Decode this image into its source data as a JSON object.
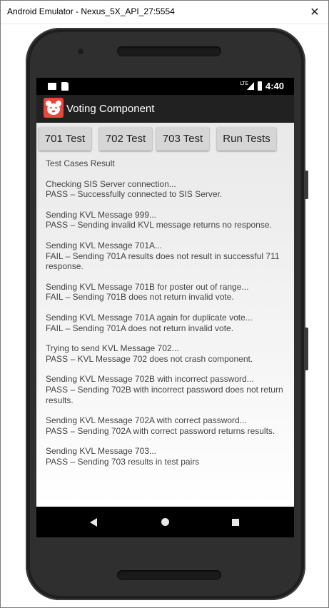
{
  "window": {
    "title": "Android Emulator - Nexus_5X_API_27:5554",
    "close_glyph": "✕"
  },
  "statusbar": {
    "lte": "LTE",
    "time": "4:40",
    "icons": [
      "notification-icon",
      "sdcard-icon",
      "signal-icon",
      "battery-icon"
    ]
  },
  "app": {
    "title": "Voting Component",
    "icon_color": "#e8483b"
  },
  "buttons": {
    "test701": "701 Test",
    "test702": "702 Test",
    "test703": "703 Test",
    "run": "Run Tests"
  },
  "results": {
    "heading": "Test Cases Result",
    "entries": [
      {
        "action": "Checking SIS Server connection...",
        "result": "PASS – Successfully connected to SIS Server."
      },
      {
        "action": "Sending KVL Message 999...",
        "result": "PASS – Sending invalid KVL message returns no response."
      },
      {
        "action": "Sending KVL Message 701A...",
        "result": "FAIL – Sending 701A results does not result in successful 711 response."
      },
      {
        "action": "Sending KVL Message 701B for poster out of range...",
        "result": "FAIL – Sending 701B does not return invalid vote."
      },
      {
        "action": "Sending KVL Message 701A again for duplicate vote...",
        "result": "FAIL – Sending 701A does not return invalid vote."
      },
      {
        "action": "Trying to send KVL Message 702...",
        "result": "PASS – KVL Message 702 does not crash component."
      },
      {
        "action": "Sending KVL Message 702B with incorrect password...",
        "result": "PASS – Sending 702B with incorrect password does not return results."
      },
      {
        "action": "Sending KVL Message 702A with correct password...",
        "result": "PASS – Sending 702A with correct password returns results."
      },
      {
        "action": "Sending KVL Message 703...",
        "result": "PASS – Sending 703 results in test pairs"
      }
    ]
  },
  "navbar": {
    "icons": [
      "back-icon",
      "home-icon",
      "recents-icon"
    ]
  }
}
